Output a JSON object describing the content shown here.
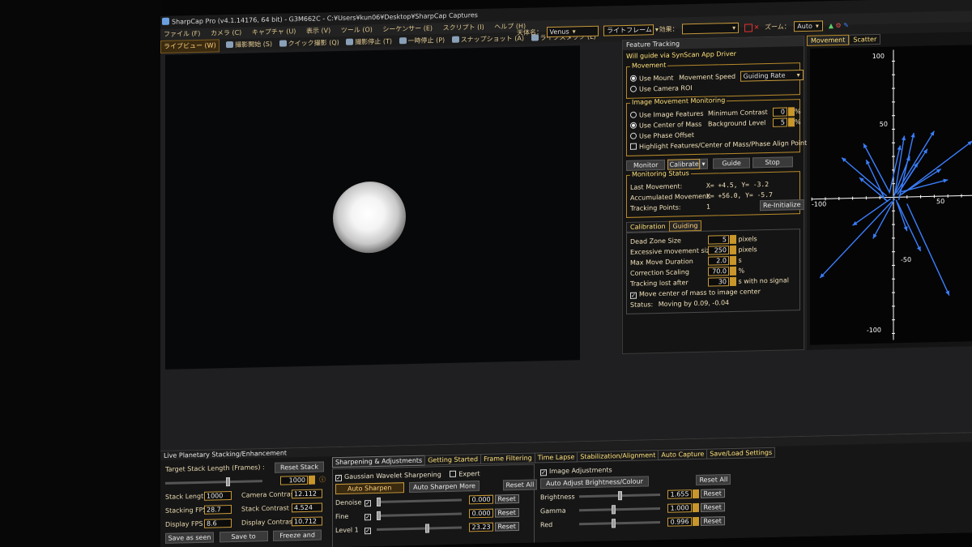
{
  "window": {
    "title": "SharpCap Pro (v4.1.14176, 64 bit) - G3M662C - C:¥Users¥kun06¥Desktop¥SharpCap Captures"
  },
  "menu": [
    "ファイル (F)",
    "カメラ (C)",
    "キャプチャ (U)",
    "表示 (V)",
    "ツール (O)",
    "シーケンサー (E)",
    "スクリプト (I)",
    "ヘルプ (H)"
  ],
  "toolbar": {
    "live_view": "ライブビュー (W)",
    "items": [
      "撮影開始 (S)",
      "クイック撮影 (Q)",
      "撮影停止 (T)",
      "一時停止 (P)",
      "スナップショット (A)",
      "ライブスタック (L)"
    ]
  },
  "controls": {
    "target_label": "天体名：",
    "target_value": "Venus",
    "frame_value": "ライトフレーム",
    "effect_label": "効果：",
    "effect_value": "",
    "zoom_label": "ズーム：",
    "zoom_value": "Auto"
  },
  "feature_tracking": {
    "title": "Feature Tracking",
    "guide_text": "Will guide via SynScan App Driver",
    "movement": {
      "title": "Movement",
      "use_mount": "Use Mount",
      "movement_speed_label": "Movement Speed",
      "movement_speed_value": "Guiding Rate",
      "use_camera_roi": "Use Camera ROI"
    },
    "monitoring": {
      "title": "Image Movement Monitoring",
      "use_image_features": "Use Image Features",
      "use_center_of_mass": "Use Center of Mass",
      "use_phase_offset": "Use Phase Offset",
      "minimum_contrast_label": "Minimum Contrast",
      "minimum_contrast_value": "0",
      "background_level_label": "Background Level",
      "background_level_value": "5",
      "percent": "%",
      "highlight": "Highlight Features/Center of Mass/Phase Align Point"
    },
    "buttons": {
      "monitor": "Monitor",
      "calibrate": "Calibrate",
      "guide": "Guide",
      "stop": "Stop"
    },
    "status": {
      "title": "Monitoring Status",
      "last_movement_label": "Last Movement:",
      "last_movement_value": "X=   +4.5, Y=   -3.2",
      "accumulated_label": "Accumulated Movement:",
      "accumulated_value": "X=  +56.0, Y=   -5.7",
      "tracking_points_label": "Tracking Points:",
      "tracking_points_value": "1",
      "reinitialize": "Re-Initialize"
    },
    "tabs": [
      "Calibration",
      "Guiding"
    ],
    "guiding": {
      "dead_zone_label": "Dead Zone Size",
      "dead_zone_value": "5",
      "dead_zone_unit": "pixels",
      "excessive_label": "Excessive movement size",
      "excessive_value": "250",
      "excessive_unit": "pixels",
      "max_move_label": "Max Move Duration",
      "max_move_value": "2.0",
      "max_move_unit": "s",
      "correction_label": "Correction Scaling",
      "correction_value": "70.0",
      "correction_unit": "%",
      "lost_label": "Tracking lost after",
      "lost_value": "30",
      "lost_unit": "s with no signal",
      "move_center": "Move center of mass to image center",
      "status_label": "Status:",
      "status_value": "Moving by 0.09, -0.04"
    }
  },
  "plot": {
    "tabs": [
      "Movement",
      "Scatter"
    ],
    "ticks": {
      "y_top": "100",
      "y_mid": "50",
      "y_neg_mid": "-50",
      "y_bottom": "-100",
      "x_left": "-100",
      "x_mid": "50"
    },
    "axis_color": "#ffffff",
    "vector_color": "#3a7fff",
    "arrows": [
      [
        2,
        3,
        30,
        48
      ],
      [
        4,
        -2,
        15,
        47
      ],
      [
        -3,
        4,
        -22,
        40
      ],
      [
        6,
        2,
        58,
        40
      ],
      [
        -1,
        -3,
        -54,
        -58
      ],
      [
        10,
        -5,
        41,
        -73
      ],
      [
        1,
        2,
        8,
        45
      ],
      [
        -5,
        1,
        -38,
        30
      ],
      [
        3,
        -4,
        20,
        -40
      ],
      [
        -2,
        -1,
        -30,
        -20
      ],
      [
        5,
        5,
        25,
        35
      ],
      [
        0,
        0,
        12,
        30
      ],
      [
        -6,
        -2,
        -20,
        28
      ],
      [
        4,
        1,
        35,
        20
      ],
      [
        2,
        -2,
        10,
        -25
      ],
      [
        -3,
        3,
        5,
        38
      ],
      [
        1,
        -1,
        -15,
        -30
      ],
      [
        6,
        4,
        40,
        12
      ],
      [
        -4,
        -3,
        -25,
        15
      ],
      [
        3,
        2,
        18,
        25
      ]
    ]
  },
  "stacking": {
    "title": "Live Planetary Stacking/Enhancement",
    "target_stack_label": "Target Stack Length (Frames) :",
    "reset_stack": "Reset Stack",
    "target_stack_value": "1000",
    "stack_length_label": "Stack Length :",
    "stack_length_value": "1000",
    "camera_contrast_label": "Camera Contrast :",
    "camera_contrast_value": "12.112",
    "stacking_fps_label": "Stacking FPS :",
    "stacking_fps_value": "28.7",
    "stack_contrast_label": "Stack Contrast :",
    "stack_contrast_value": "4.524",
    "display_fps_label": "Display FPS :",
    "display_fps_value": "8.6",
    "display_contrast_label": "Display Contrast :",
    "display_contrast_value": "10.712",
    "save_as_seen": "Save as seen",
    "save_to": "Save to",
    "freeze_and": "Freeze and"
  },
  "sharpening": {
    "tabs": [
      "Sharpening & Adjustments",
      "Getting Started",
      "Frame Filtering",
      "Time Lapse",
      "Stabilization/Alignment",
      "Auto Capture",
      "Save/Load Settings"
    ],
    "gaussian": "Gaussian Wavelet Sharpening",
    "expert": "Expert",
    "auto_sharpen": "Auto Sharpen",
    "auto_sharpen_more": "Auto Sharpen More",
    "reset_all": "Reset All",
    "denoise_label": "Denoise",
    "denoise_value": "0.000",
    "fine_label": "Fine",
    "fine_value": "0.000",
    "level1_label": "Level 1",
    "level1_value": "23.23",
    "reset": "Reset"
  },
  "adjustments": {
    "title": "Image Adjustments",
    "auto_adjust": "Auto Adjust Brightness/Colour",
    "reset_all": "Reset All",
    "brightness_label": "Brightness",
    "brightness_value": "1.655",
    "gamma_label": "Gamma",
    "gamma_value": "1.000",
    "red_label": "Red",
    "red_value": "0.996",
    "reset": "Reset"
  }
}
